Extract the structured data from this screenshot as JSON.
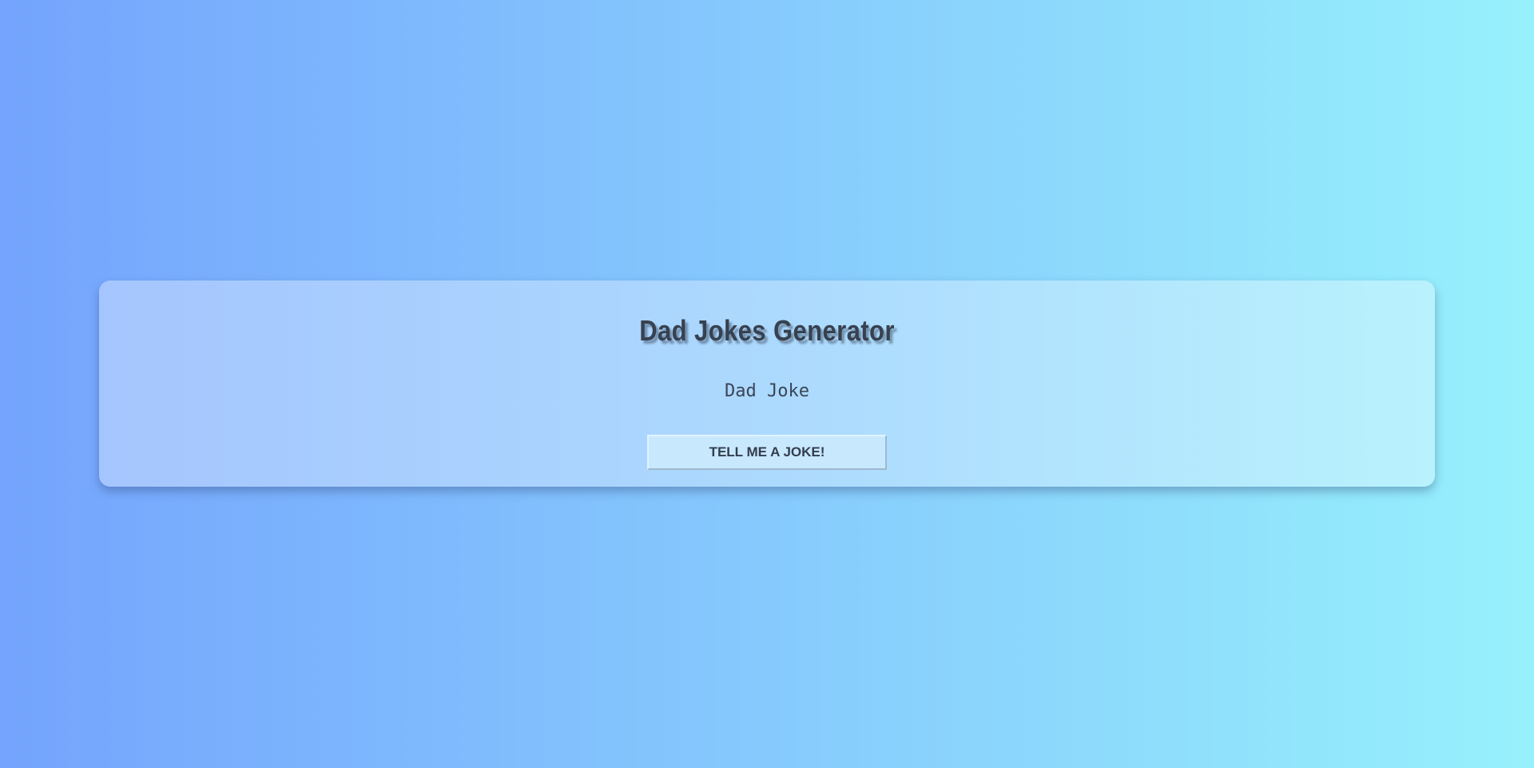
{
  "app": {
    "title": "Dad Jokes Generator"
  },
  "joke": {
    "text": "Dad Joke"
  },
  "actions": {
    "tell_joke_label": "TELL ME A JOKE!"
  },
  "colors": {
    "background_start": "#74a4fd",
    "background_end": "#97f1fc",
    "card_start": "#a5c5fe",
    "card_end": "#b9f2fd",
    "button": "#c8e8fe",
    "text": "#374150"
  }
}
